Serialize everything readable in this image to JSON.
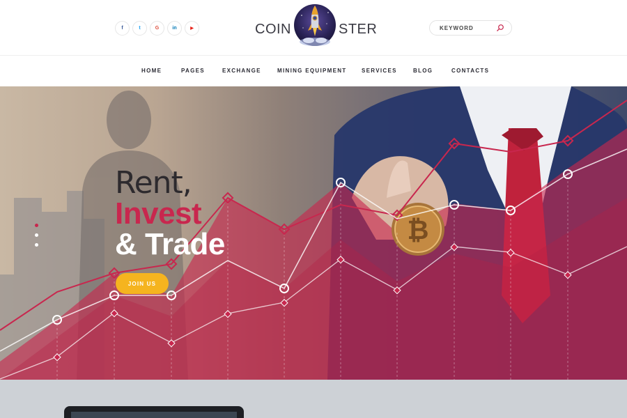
{
  "header": {
    "social": [
      {
        "name": "facebook",
        "glyph": "f",
        "color": "#3b5998"
      },
      {
        "name": "twitter",
        "glyph": "t",
        "color": "#1da1f2"
      },
      {
        "name": "google",
        "glyph": "G",
        "color": "#dd4b39"
      },
      {
        "name": "linkedin",
        "glyph": "in",
        "color": "#0077b5"
      },
      {
        "name": "youtube",
        "glyph": "▶",
        "color": "#e62117"
      }
    ],
    "logo": {
      "left": "COIN",
      "right": "STER"
    },
    "search": {
      "placeholder": "KEYWORD",
      "value": ""
    }
  },
  "nav": {
    "items": [
      "HOME",
      "PAGES",
      "EXCHANGE",
      "MINING EQUIPMENT",
      "SERVICES",
      "BLOG",
      "CONTACTS"
    ]
  },
  "hero": {
    "line1": "Rent,",
    "line2": "Invest",
    "line3": "& Trade",
    "cta": "JOIN US"
  },
  "colors": {
    "accent": "#c8274e",
    "cta": "#f5b41f",
    "text": "#2a2a33"
  }
}
